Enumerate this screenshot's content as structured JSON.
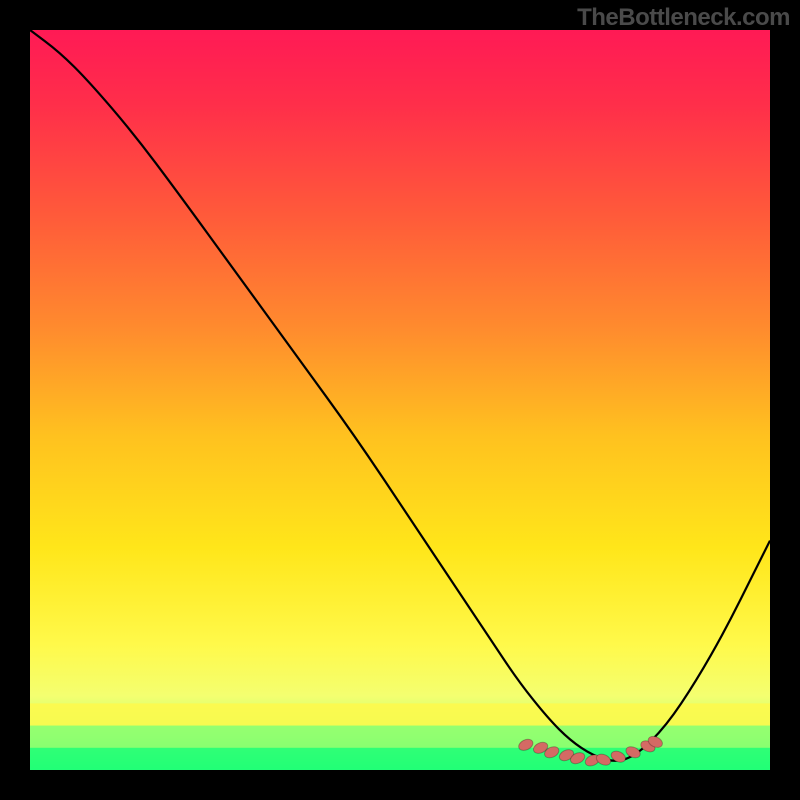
{
  "watermark": "TheBottleneck.com",
  "colors": {
    "background": "#000000",
    "watermark": "#4a4a4a",
    "gradient_stops": [
      {
        "offset": 0.0,
        "color": "#ff1a55"
      },
      {
        "offset": 0.1,
        "color": "#ff2e4a"
      },
      {
        "offset": 0.25,
        "color": "#ff5a3a"
      },
      {
        "offset": 0.4,
        "color": "#ff8a2e"
      },
      {
        "offset": 0.55,
        "color": "#ffc21f"
      },
      {
        "offset": 0.7,
        "color": "#ffe61a"
      },
      {
        "offset": 0.83,
        "color": "#fff94a"
      },
      {
        "offset": 0.9,
        "color": "#f4ff70"
      },
      {
        "offset": 0.95,
        "color": "#b6ff70"
      },
      {
        "offset": 1.0,
        "color": "#22ff77"
      }
    ],
    "curve": "#000000",
    "marker_fill": "#d46a64",
    "marker_stroke": "rgba(0,0,0,0.25)",
    "bottom_band_yellow": "#fff94a",
    "bottom_band_green1": "#8cff70",
    "bottom_band_green2": "#22ff77"
  },
  "chart_data": {
    "type": "line",
    "title": "",
    "xlabel": "",
    "ylabel": "",
    "xlim": [
      0,
      100
    ],
    "ylim": [
      0,
      100
    ],
    "series": [
      {
        "name": "bottleneck-curve",
        "x": [
          0,
          4,
          8,
          14,
          20,
          28,
          36,
          44,
          52,
          58,
          62,
          66,
          70,
          73,
          76,
          79,
          82,
          86,
          90,
          94,
          98,
          100
        ],
        "y": [
          100,
          97,
          93,
          86,
          78,
          67,
          56,
          45,
          33,
          24,
          18,
          12,
          7,
          4,
          2,
          1,
          2,
          6,
          12,
          19,
          27,
          31
        ]
      }
    ],
    "marker_points": {
      "name": "optimum-range-markers",
      "x": [
        67.0,
        69.0,
        70.5,
        72.5,
        74.0,
        76.0,
        77.5,
        79.5,
        81.5,
        83.5,
        84.5
      ],
      "y": [
        3.4,
        3.0,
        2.4,
        2.0,
        1.6,
        1.3,
        1.4,
        1.8,
        2.4,
        3.2,
        3.8
      ]
    }
  }
}
